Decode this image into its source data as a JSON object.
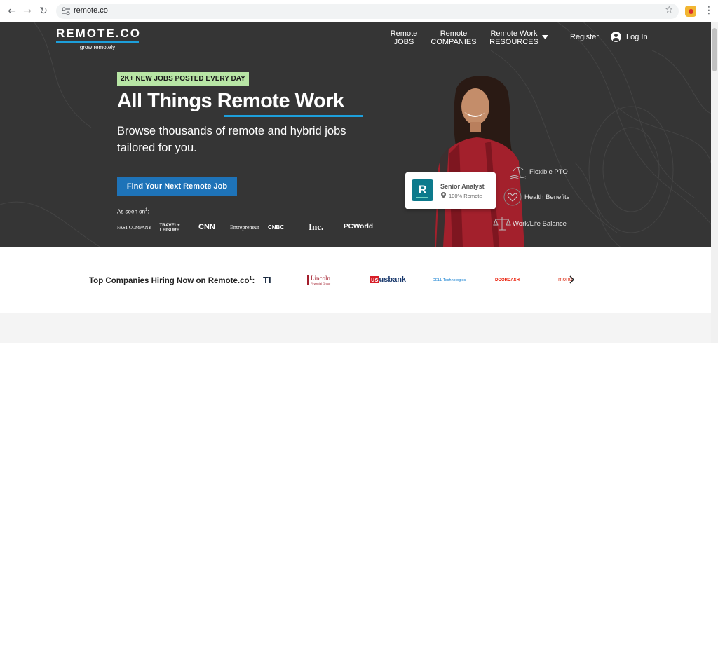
{
  "browser": {
    "url": "remote.co",
    "back_icon": "back-arrow-icon",
    "forward_icon": "forward-arrow-icon",
    "reload_icon": "reload-icon"
  },
  "header": {
    "logo_text": "REMOTE.CO",
    "logo_tagline": "grow remotely",
    "nav": {
      "jobs_line1": "Remote",
      "jobs_line2": "JOBS",
      "companies_line1": "Remote",
      "companies_line2": "COMPANIES",
      "resources_line1": "Remote Work",
      "resources_line2": "RESOURCES"
    },
    "register": "Register",
    "login": "Log In"
  },
  "hero": {
    "badge": "2K+ NEW JOBS POSTED EVERY DAY",
    "headline_part1": "All Things ",
    "headline_part2": "Remote Work",
    "subhead": "Browse thousands of remote and hybrid jobs tailored for you.",
    "cta": "Find Your Next Remote Job",
    "as_seen_on": "As seen on",
    "as_seen_on_sup": "1",
    "as_seen_on_suffix": ":",
    "press": [
      "FAST COMPANY",
      "TRAVEL+ LEISURE",
      "CNN",
      "Entrepreneur",
      "CNBC",
      "Inc.",
      "PCWorld"
    ]
  },
  "job_card": {
    "logo_letter": "R",
    "title": "Senior Analyst",
    "location": "100% Remote"
  },
  "perks": [
    "Flexible PTO",
    "Health Benefits",
    "Work/Life Balance"
  ],
  "companies": {
    "label": "Top Companies Hiring Now on Remote.co",
    "label_sup": "1",
    "label_suffix": ":",
    "logos": [
      "TI",
      "Lincoln",
      "Financial Group",
      "usbank",
      "DELL Technologies",
      "DOORDASH",
      "mond"
    ]
  },
  "colors": {
    "hero_bg": "#353535",
    "accent_blue": "#1d9fdb",
    "cta_blue": "#1e73b8",
    "badge_green": "#b8e6a5",
    "card_teal": "#0c7a8c"
  }
}
